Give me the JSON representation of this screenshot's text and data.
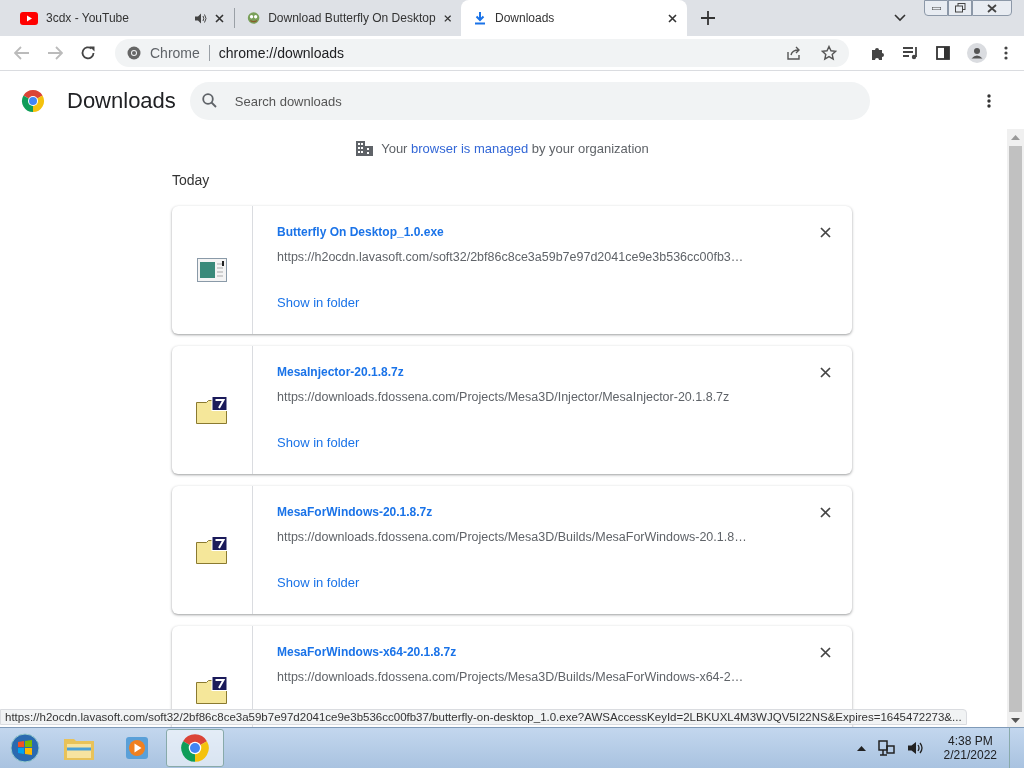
{
  "tabs": [
    {
      "title": "3cdx - YouTube",
      "kind": "video",
      "audio": true,
      "selected": false
    },
    {
      "title": "Download Butterfly On Desktop",
      "kind": "page",
      "audio": false,
      "selected": false
    },
    {
      "title": "Downloads",
      "kind": "download",
      "audio": false,
      "selected": true
    }
  ],
  "address_bar": {
    "chip": "Chrome",
    "url": "chrome://downloads"
  },
  "page": {
    "title": "Downloads",
    "search": {
      "placeholder": "Search downloads"
    },
    "notice": {
      "before": "Your",
      "link": "browser is managed",
      "after": "by your organization"
    },
    "section": "Today",
    "downloads": [
      {
        "kind": "exe",
        "name": "Butterfly On Desktop_1.0.exe",
        "url": "https://h2ocdn.lavasoft.com/soft32/2bf86c8ce3a59b7e97d2041ce9e3b536cc00fb3…",
        "action": "Show in folder"
      },
      {
        "kind": "archive",
        "name": "MesaInjector-20.1.8.7z",
        "url": "https://downloads.fdossena.com/Projects/Mesa3D/Injector/MesaInjector-20.1.8.7z",
        "action": "Show in folder"
      },
      {
        "kind": "archive",
        "name": "MesaForWindows-20.1.8.7z",
        "url": "https://downloads.fdossena.com/Projects/Mesa3D/Builds/MesaForWindows-20.1.8…",
        "action": "Show in folder"
      },
      {
        "kind": "archive",
        "name": "MesaForWindows-x64-20.1.8.7z",
        "url": "https://downloads.fdossena.com/Projects/Mesa3D/Builds/MesaForWindows-x64-2…"
      }
    ]
  },
  "status_bubble": "https://h2ocdn.lavasoft.com/soft32/2bf86c8ce3a59b7e97d2041ce9e3b536cc00fb37/butterfly-on-desktop_1.0.exe?AWSAccessKeyId=2LBKUXL4M3WJQV5I22NS&Expires=1645472273&...",
  "taskbar": {
    "apps": [
      {
        "kind": "explorer",
        "selected": false
      },
      {
        "kind": "media",
        "selected": false
      },
      {
        "kind": "chrome",
        "selected": true
      }
    ],
    "time": "4:38 PM",
    "date": "2/21/2022"
  }
}
